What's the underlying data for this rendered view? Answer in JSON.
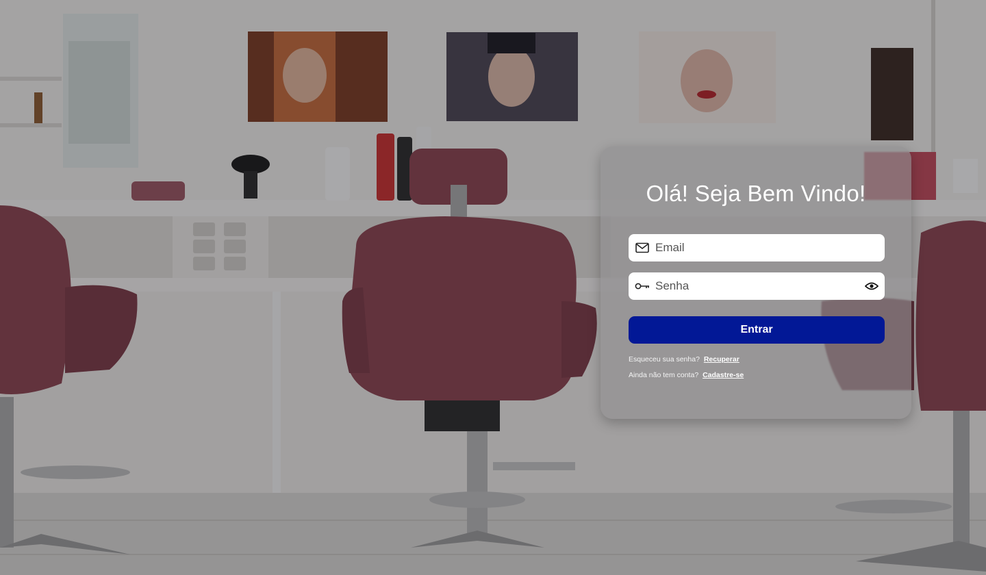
{
  "login": {
    "title": "Olá! Seja Bem Vindo!",
    "email_placeholder": "Email",
    "password_placeholder": "Senha",
    "submit_label": "Entrar",
    "forgot_text": "Esqueceu sua senha?",
    "forgot_link": "Recuperar",
    "signup_text": "Ainda não tem conta?",
    "signup_link": "Cadastre-se"
  },
  "icons": {
    "email": "mail-icon",
    "password": "key-icon",
    "toggle": "eye-icon"
  },
  "colors": {
    "button": "#021896",
    "card": "rgba(146,143,146,0.62)",
    "chair": "#8a4350"
  }
}
